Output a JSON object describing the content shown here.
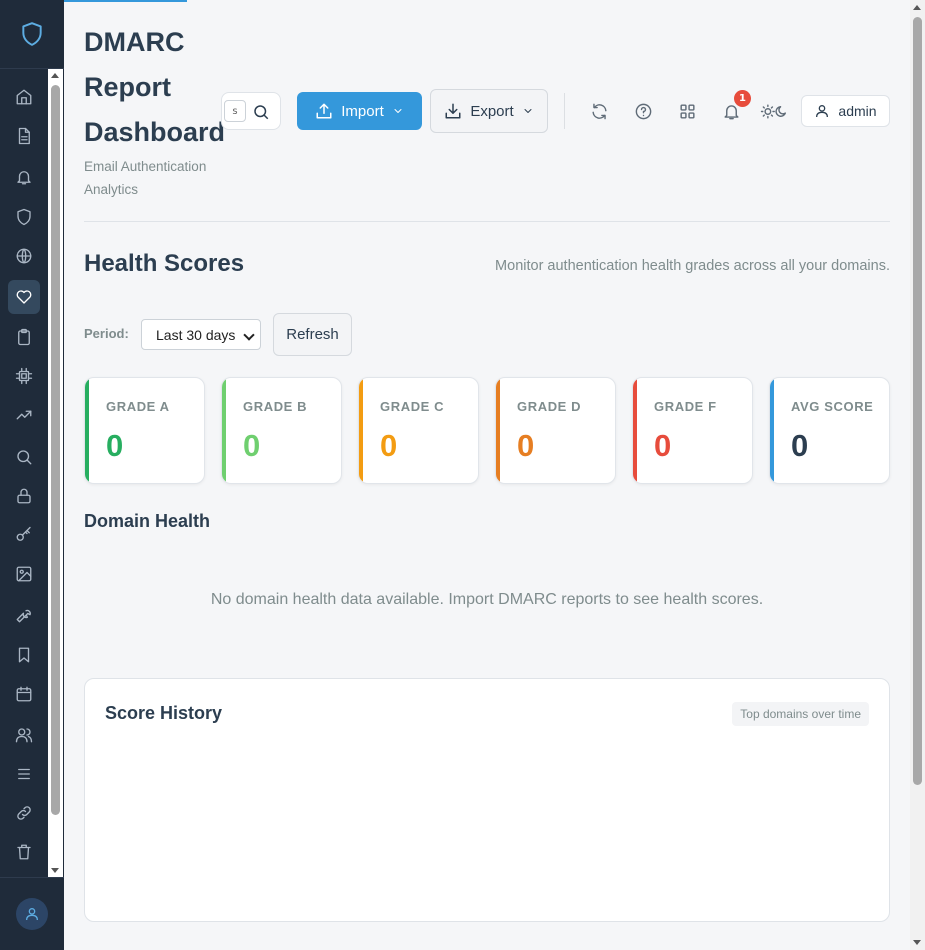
{
  "header": {
    "title": "DMARC Report Dashboard",
    "subtitle": "Email Authentication Analytics",
    "search_kbd": "s",
    "import_label": "Import",
    "export_label": "Export",
    "notification_count": "1",
    "user_label": "admin"
  },
  "sidebar": {
    "items": [
      {
        "icon": "home-icon"
      },
      {
        "icon": "file-text-icon"
      },
      {
        "icon": "bell-icon"
      },
      {
        "icon": "shield-icon"
      },
      {
        "icon": "globe-icon"
      },
      {
        "icon": "heart-icon",
        "active": true
      },
      {
        "icon": "clipboard-icon"
      },
      {
        "icon": "cpu-icon"
      },
      {
        "icon": "trending-up-icon"
      },
      {
        "icon": "search-icon"
      },
      {
        "icon": "lock-icon"
      },
      {
        "icon": "key-icon"
      },
      {
        "icon": "image-icon"
      },
      {
        "icon": "wrench-icon"
      },
      {
        "icon": "bookmark-icon"
      },
      {
        "icon": "calendar-icon"
      },
      {
        "icon": "users-icon"
      },
      {
        "icon": "list-icon"
      },
      {
        "icon": "link-icon"
      },
      {
        "icon": "trash-icon"
      }
    ]
  },
  "health": {
    "title": "Health Scores",
    "description": "Monitor authentication health grades across all your domains.",
    "period_label": "Period:",
    "period_value": "Last 30 days",
    "refresh_label": "Refresh",
    "cards": [
      {
        "label": "GRADE A",
        "value": "0",
        "color": "#27ae60"
      },
      {
        "label": "GRADE B",
        "value": "0",
        "color": "#6fcf6f"
      },
      {
        "label": "GRADE C",
        "value": "0",
        "color": "#f39c12"
      },
      {
        "label": "GRADE D",
        "value": "0",
        "color": "#e67e22"
      },
      {
        "label": "GRADE F",
        "value": "0",
        "color": "#e74c3c"
      },
      {
        "label": "AVG SCORE",
        "value": "0",
        "color": "#3498db"
      }
    ],
    "domain_health_title": "Domain Health",
    "empty_message": "No domain health data available. Import DMARC reports to see health scores."
  },
  "history": {
    "title": "Score History",
    "tag": "Top domains over time"
  },
  "colors": {
    "accent": "#3498db",
    "sidebar_bg": "#1f2b3a",
    "badge": "#e74c3c"
  }
}
